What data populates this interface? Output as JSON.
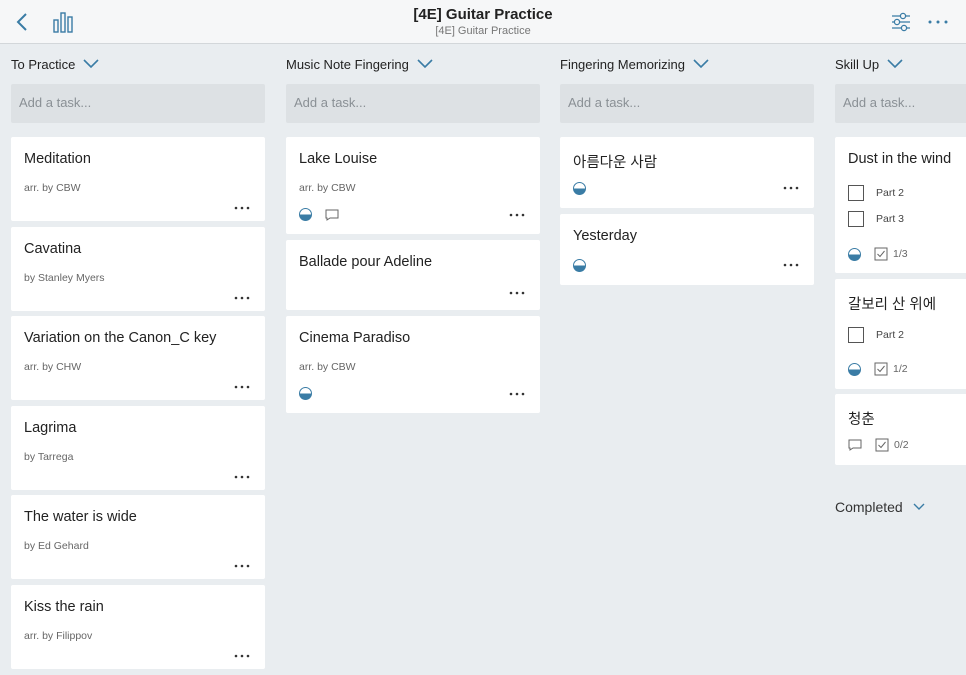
{
  "header": {
    "title": "[4E] Guitar Practice",
    "subtitle": "[4E] Guitar Practice"
  },
  "add_task_placeholder": "Add a task...",
  "columns": [
    {
      "title": "To Practice",
      "cards": [
        {
          "title": "Meditation",
          "subtitle": "arr. by CBW"
        },
        {
          "title": "Cavatina",
          "subtitle": "by Stanley Myers"
        },
        {
          "title": "Variation on the Canon_C key",
          "subtitle": "arr. by CHW"
        },
        {
          "title": "Lagrima",
          "subtitle": "by Tarrega"
        },
        {
          "title": "The water is wide",
          "subtitle": "by Ed Gehard"
        },
        {
          "title": "Kiss the rain",
          "subtitle": "arr. by Filippov"
        }
      ]
    },
    {
      "title": "Music Note Fingering",
      "cards": [
        {
          "title": "Lake Louise",
          "subtitle": "arr. by CBW"
        },
        {
          "title": "Ballade pour Adeline"
        },
        {
          "title": "Cinema Paradiso",
          "subtitle": "arr. by CBW"
        }
      ]
    },
    {
      "title": "Fingering Memorizing",
      "cards": [
        {
          "title": "아름다운 사람"
        },
        {
          "title": "Yesterday"
        }
      ]
    },
    {
      "title": "Skill Up",
      "cards": [
        {
          "title": "Dust in the wind",
          "items": [
            "Part 2",
            "Part 3"
          ],
          "checklist_count": "1/3"
        },
        {
          "title": "갈보리 산 위에",
          "items": [
            "Part 2"
          ],
          "checklist_count": "1/2"
        },
        {
          "title": "청춘",
          "checklist_count": "0/2"
        }
      ]
    }
  ],
  "completed_label": "Completed",
  "colors": {
    "accent": "#3a7ca5",
    "background": "#e9edf0",
    "card": "#ffffff"
  },
  "icons": {
    "back": "chevron-left-icon",
    "stats": "bar-chart-icon",
    "filter": "sliders-icon",
    "more": "more-horizontal-icon",
    "progress": "half-circle-progress-icon",
    "comment": "comment-icon",
    "checklist": "checklist-icon"
  }
}
